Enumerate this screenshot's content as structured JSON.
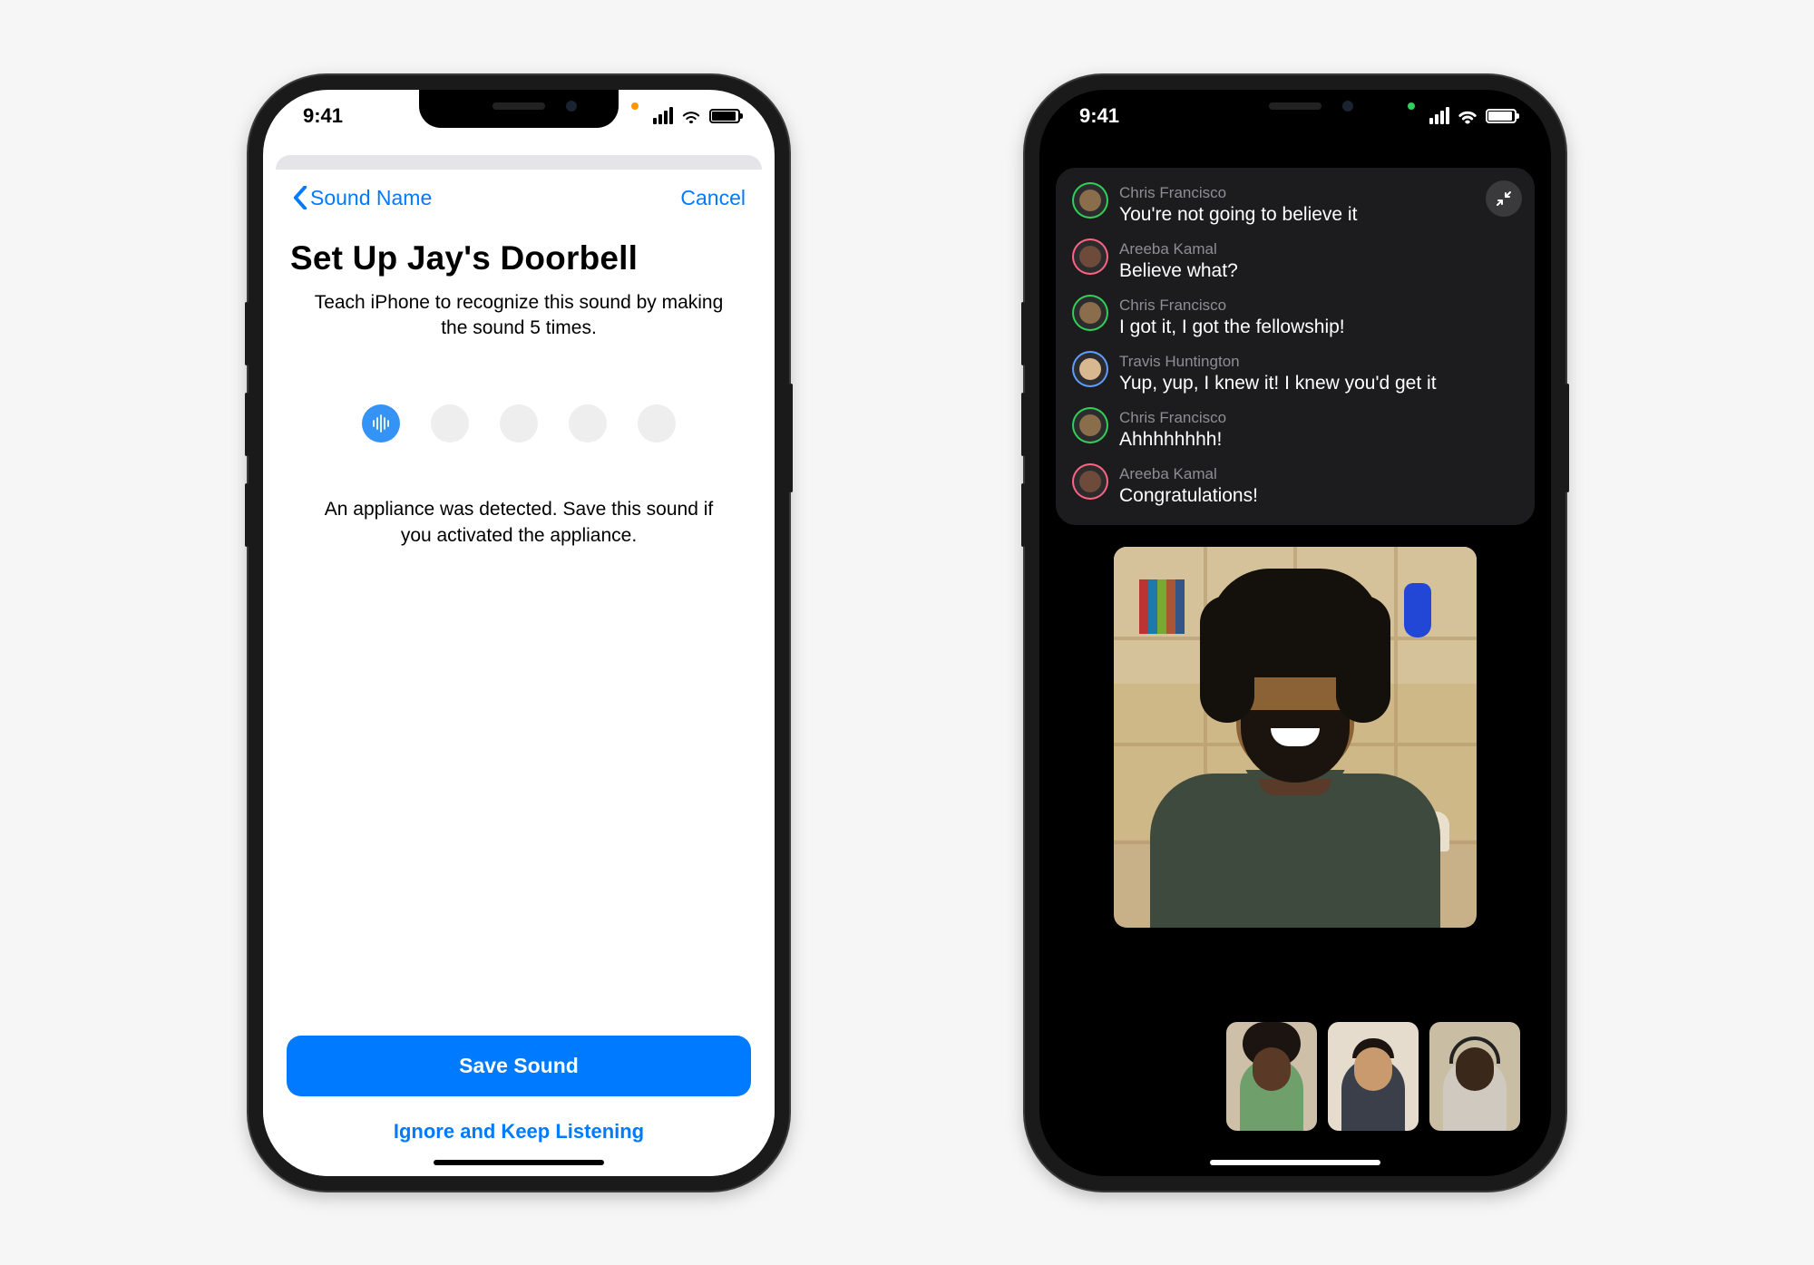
{
  "status": {
    "time": "9:41"
  },
  "left_phone": {
    "nav": {
      "back_label": "Sound Name",
      "cancel_label": "Cancel"
    },
    "title": "Set Up Jay's Doorbell",
    "subtitle": "Teach iPhone to recognize this sound by making the sound 5 times.",
    "progress": {
      "total": 5,
      "completed": 1
    },
    "detection_msg": "An appliance was detected. Save this sound if you activated the appliance.",
    "save_label": "Save Sound",
    "ignore_label": "Ignore and Keep Listening"
  },
  "right_phone": {
    "captions": [
      {
        "speaker": "Chris Francisco",
        "text": "You're not going to believe it",
        "ring": "green"
      },
      {
        "speaker": "Areeba Kamal",
        "text": "Believe what?",
        "ring": "pink"
      },
      {
        "speaker": "Chris Francisco",
        "text": "I got it, I got the fellowship!",
        "ring": "green"
      },
      {
        "speaker": "Travis Huntington",
        "text": "Yup, yup, I knew it! I knew you'd get it",
        "ring": "blue"
      },
      {
        "speaker": "Chris Francisco",
        "text": "Ahhhhhhhh!",
        "ring": "green"
      },
      {
        "speaker": "Areeba Kamal",
        "text": "Congratulations!",
        "ring": "pink"
      }
    ],
    "participants_small": 3
  }
}
